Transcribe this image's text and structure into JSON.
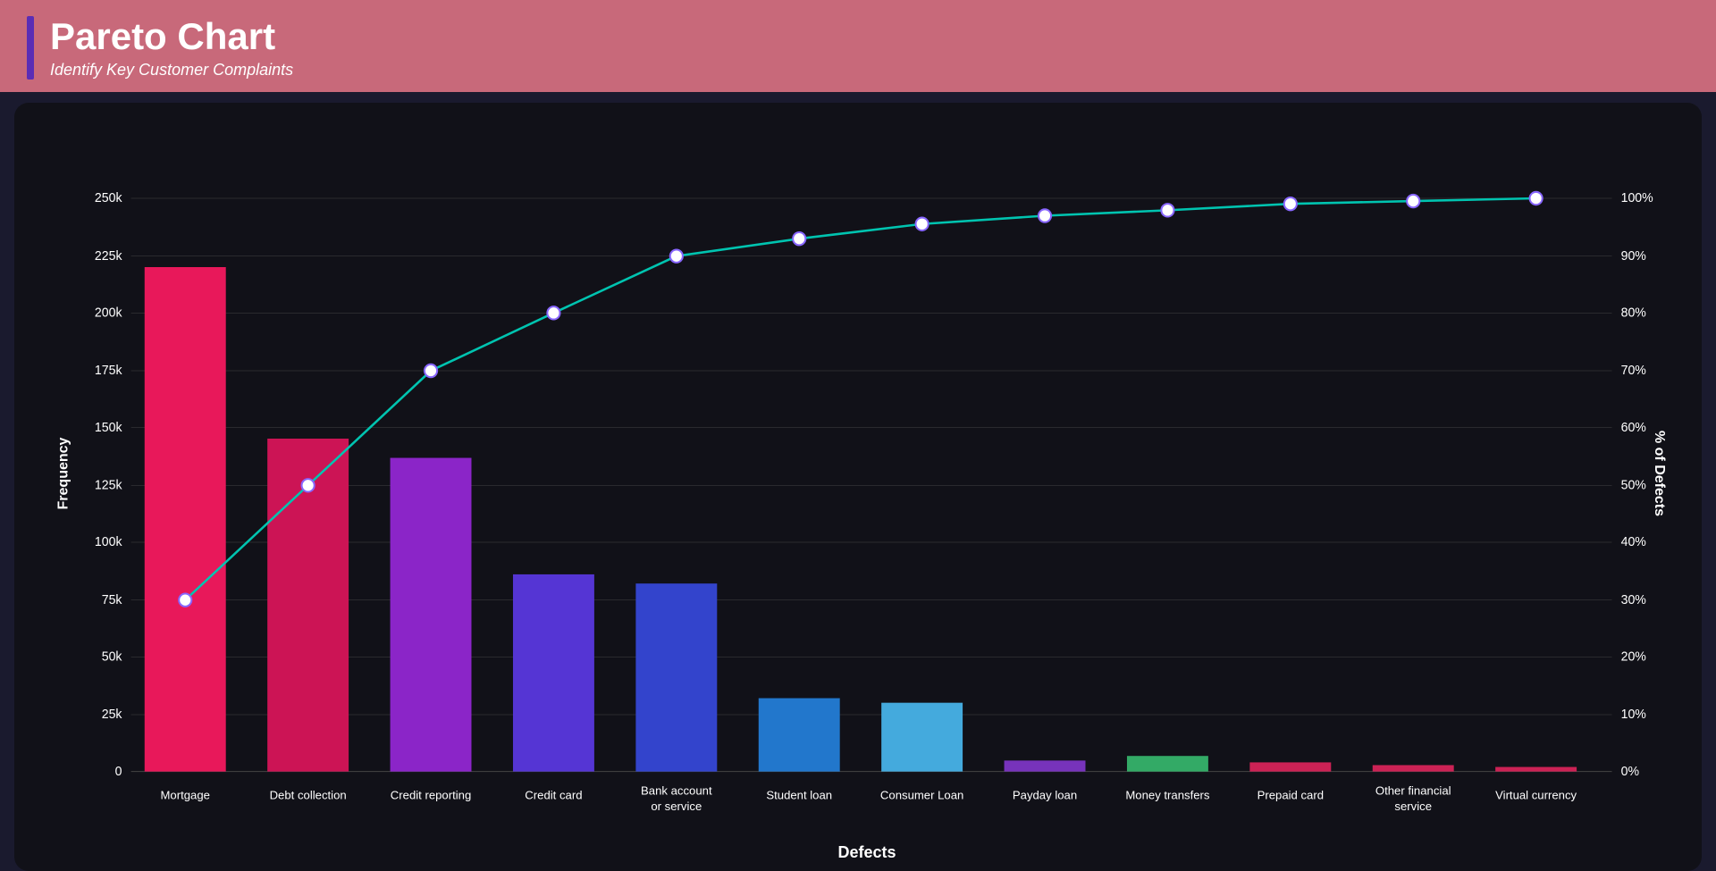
{
  "header": {
    "title": "Pareto Chart",
    "subtitle": "Identify Key Customer Complaints"
  },
  "chart": {
    "yAxisLeft": "Frequency",
    "yAxisRight": "% of Defects",
    "xAxisLabel": "Defects",
    "yLabels": [
      "0",
      "25k",
      "50k",
      "75k",
      "100k",
      "125k",
      "150k",
      "175k",
      "200k",
      "225k",
      "250k"
    ],
    "yPercents": [
      "0%",
      "10%",
      "20%",
      "30%",
      "40%",
      "50%",
      "60%",
      "70%",
      "80%",
      "90%",
      "100%"
    ],
    "bars": [
      {
        "label": "Mortgage",
        "value": 220000,
        "color": "#e8185a"
      },
      {
        "label": "Debt collection",
        "value": 145000,
        "color": "#c8185a"
      },
      {
        "label": "Credit reporting",
        "value": 137000,
        "color": "#8b25c8"
      },
      {
        "label": "Credit card",
        "value": 86000,
        "color": "#5535d4"
      },
      {
        "label": "Bank account\nor service",
        "value": 82000,
        "color": "#3344cc"
      },
      {
        "label": "Student loan",
        "value": 32000,
        "color": "#2277cc"
      },
      {
        "label": "Consumer Loan",
        "value": 30000,
        "color": "#44aadd"
      },
      {
        "label": "Payday loan",
        "value": 5000,
        "color": "#7733bb"
      },
      {
        "label": "Money transfers",
        "value": 7000,
        "color": "#33aa66"
      },
      {
        "label": "Prepaid card",
        "value": 4000,
        "color": "#cc2255"
      },
      {
        "label": "Other financial\nservice",
        "value": 3000,
        "color": "#cc2255"
      },
      {
        "label": "Virtual currency",
        "value": 2000,
        "color": "#cc2255"
      }
    ],
    "linePoints": [
      30,
      50,
      70,
      80,
      90,
      93,
      95.5,
      97,
      98,
      99,
      99.5,
      100
    ]
  }
}
